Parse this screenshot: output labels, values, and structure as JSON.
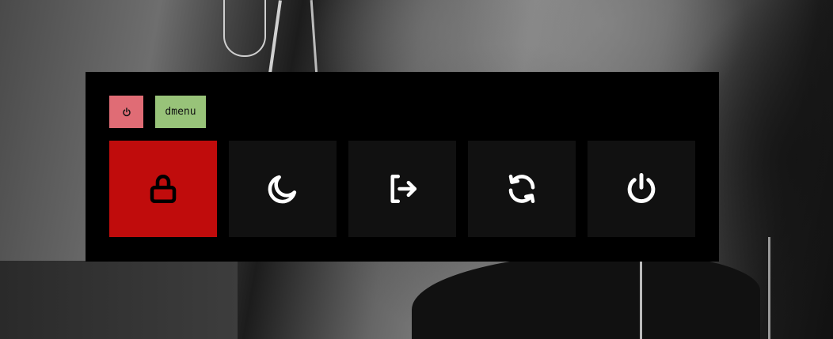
{
  "header": {
    "mode_chip": {
      "icon": "power-icon",
      "color": "#e06c75"
    },
    "prompt_chip": {
      "label": "dmenu",
      "color": "#98c379"
    }
  },
  "actions": [
    {
      "icon": "lock-icon",
      "selected": true
    },
    {
      "icon": "moon-icon",
      "selected": false
    },
    {
      "icon": "logout-icon",
      "selected": false
    },
    {
      "icon": "reboot-icon",
      "selected": false
    },
    {
      "icon": "shutdown-icon",
      "selected": false
    }
  ],
  "colors": {
    "menu_background": "#000000",
    "button_background": "#111111",
    "selected_background": "#c00c0c",
    "icon_color": "#ffffff",
    "selected_icon_color": "#000000"
  }
}
